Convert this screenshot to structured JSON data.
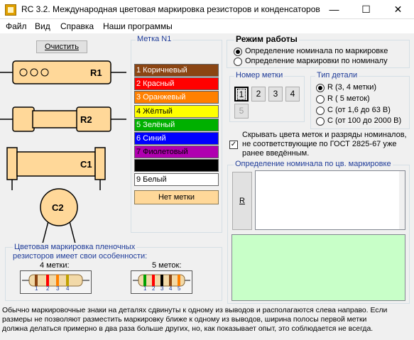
{
  "window": {
    "title": "RC 3.2. Международная цветовая маркировка резисторов и конденсаторов",
    "minimize": "—",
    "maximize": "☐",
    "close": "✕"
  },
  "menu": [
    "Файл",
    "Вид",
    "Справка",
    "Наши программы"
  ],
  "clear_button": "Очистить",
  "components": {
    "r1": "R1",
    "r2": "R2",
    "c1": "C1",
    "c2": "C2"
  },
  "mark_group": {
    "title": "Метка N1",
    "colors": [
      {
        "label": "1 Коричневый",
        "bg": "#8b4513",
        "fg": "#ffffff"
      },
      {
        "label": "2 Красный",
        "bg": "#ff0000",
        "fg": "#ffffff"
      },
      {
        "label": "3 Оранжевый",
        "bg": "#ff8000",
        "fg": "#ffffff"
      },
      {
        "label": "4 Жёлтый",
        "bg": "#ffff00",
        "fg": "#000000"
      },
      {
        "label": "5 Зелёный",
        "bg": "#00b000",
        "fg": "#ffffff"
      },
      {
        "label": "6 Синий",
        "bg": "#0000ff",
        "fg": "#ffffff"
      },
      {
        "label": "7 Фиолетовый",
        "bg": "#b000b0",
        "fg": "#000000"
      },
      {
        "label": "",
        "bg": "#000000",
        "fg": "#ffffff"
      },
      {
        "label": "9 Белый",
        "bg": "#ffffff",
        "fg": "#000000"
      }
    ],
    "no_mark": "Нет метки"
  },
  "mode": {
    "title": "Режим работы",
    "options": [
      "Определение номинала по маркировке",
      "Определение маркировки по номиналу"
    ],
    "selected": 0
  },
  "mark_number": {
    "title": "Номер метки",
    "buttons": [
      "1",
      "2",
      "3",
      "4",
      "5"
    ]
  },
  "part_type": {
    "title": "Тип детали",
    "options": [
      "R (3, 4 метки)",
      "R ( 5 меток)",
      "C (от 1,6 до 63 В)",
      "C (от 100 до 2000 В)"
    ],
    "selected": 0
  },
  "hide_checkbox": {
    "label_lines": [
      "Скрывать цвета меток и разряды номиналов,",
      "не соответствующие по ГОСТ 2825-67 уже",
      "ранее введённым."
    ],
    "checked": true,
    "mark": "✓"
  },
  "nominal": {
    "title": "Определение номинала по цв. маркировке",
    "button": "R"
  },
  "film_note": {
    "line1": "Цветовая маркировка пленочных",
    "line2": "резисторов имеет свои особенности:",
    "label4": "4 метки:",
    "label5": "5 меток:",
    "nums4": [
      "1",
      "2",
      "3",
      "4"
    ],
    "nums5": [
      "1",
      "2",
      "3",
      "4",
      "5"
    ]
  },
  "footer_lines": [
    "Обычно маркировочные знаки на деталях сдвинуты к одному из выводов и располагаются слева направо. Если",
    "размеры не позволяют разместить маркировку ближе к одному из выводов, ширина полосы первой метки",
    "должна  делаться примерно в два раза больше других, но, как показывает опыт, это соблюдается не всегда."
  ],
  "colors": {
    "component_fill": "#ffd899",
    "component_stroke": "#000000",
    "result_bg": "#c8ffc8",
    "group_label": "#1f3c99"
  }
}
